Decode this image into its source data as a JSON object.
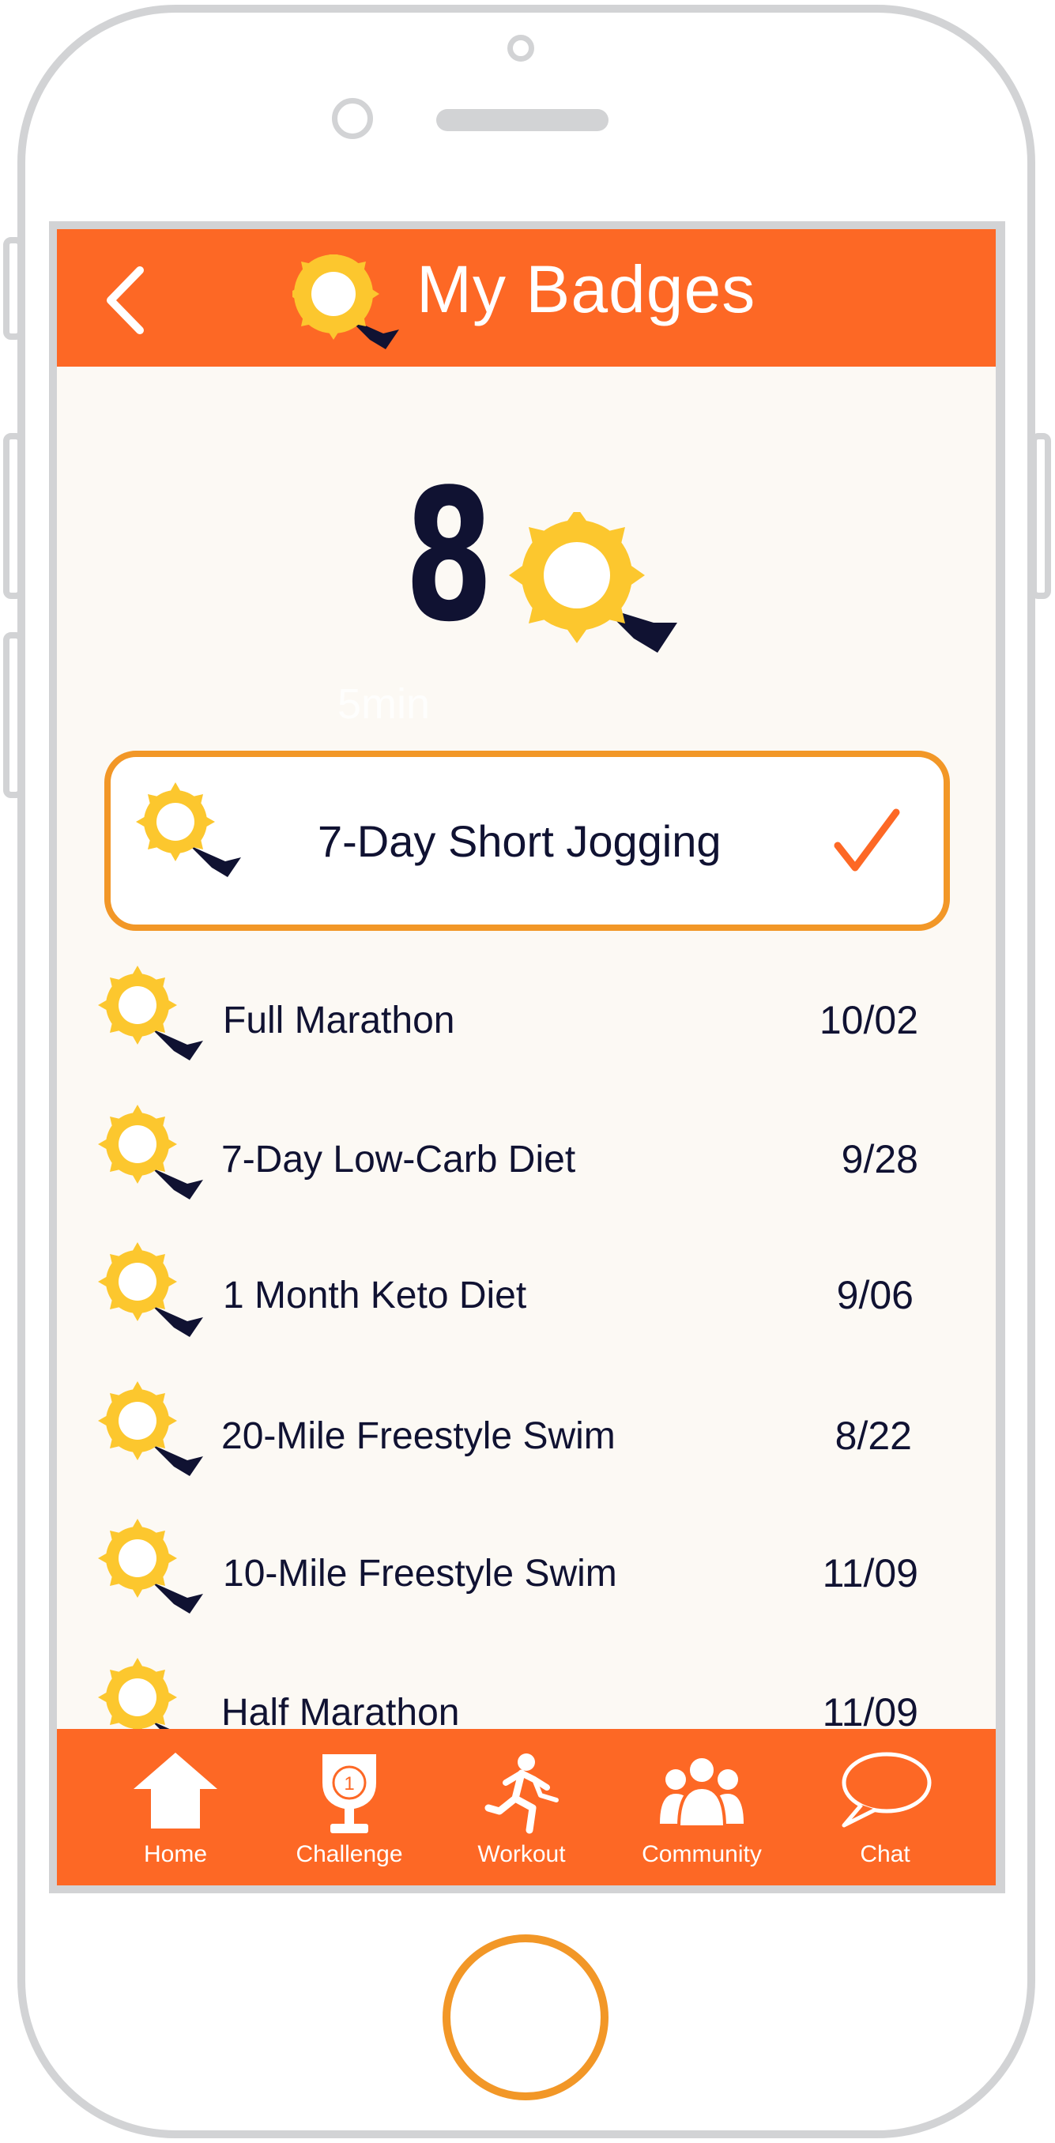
{
  "header": {
    "title": "My Badges",
    "back_icon": "back-chevron-icon",
    "title_icon": "badge-icon"
  },
  "summary": {
    "badge_count": "8",
    "faint_text": "5min"
  },
  "featured": {
    "label": "7-Day Short Jogging",
    "status_icon": "checkmark-icon"
  },
  "badges": [
    {
      "label": "Full Marathon",
      "date": "10/02"
    },
    {
      "label": "7-Day Low-Carb Diet",
      "date": "9/28"
    },
    {
      "label": "1 Month Keto Diet",
      "date": "9/06"
    },
    {
      "label": "20-Mile Freestyle Swim",
      "date": "8/22"
    },
    {
      "label": "10-Mile Freestyle Swim",
      "date": "11/09"
    },
    {
      "label": "Half Marathon",
      "date": "11/09"
    }
  ],
  "tabs": [
    {
      "label": "Home",
      "icon": "home-icon"
    },
    {
      "label": "Challenge",
      "icon": "trophy-icon"
    },
    {
      "label": "Workout",
      "icon": "runner-icon"
    },
    {
      "label": "Community",
      "icon": "community-icon"
    },
    {
      "label": "Chat",
      "icon": "chat-bubble-icon"
    }
  ],
  "colors": {
    "accent": "#fd6825",
    "border_orange": "#f29727",
    "badge_yellow": "#fcc72e",
    "ink": "#101232",
    "background": "#fcf9f4"
  }
}
